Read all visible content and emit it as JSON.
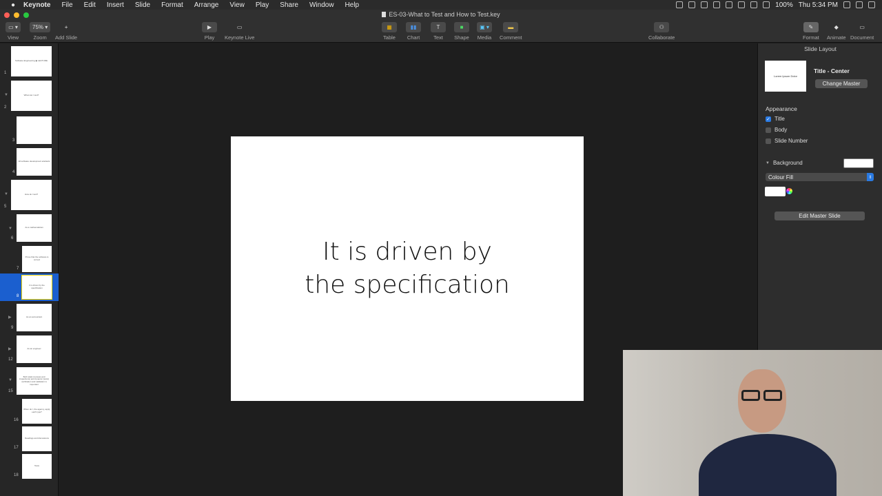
{
  "menubar": {
    "apple": "",
    "items": [
      "Keynote",
      "File",
      "Edit",
      "Insert",
      "Slide",
      "Format",
      "Arrange",
      "View",
      "Play",
      "Share",
      "Window",
      "Help"
    ],
    "battery": "100%",
    "clock": "Thu 5:34 PM"
  },
  "window": {
    "title": "ES-03-What to Test and How to Test.key"
  },
  "toolbar": {
    "view_label": "View",
    "zoom_value": "75%",
    "zoom_label": "Zoom",
    "add_slide_label": "Add Slide",
    "play_label": "Play",
    "keynote_live_label": "Keynote Live",
    "table_label": "Table",
    "chart_label": "Chart",
    "text_label": "Text",
    "shape_label": "Shape",
    "media_label": "Media",
    "comment_label": "Comment",
    "collaborate_label": "Collaborate",
    "format_label": "Format",
    "animate_label": "Animate",
    "document_label": "Document"
  },
  "navigator": {
    "slides": [
      {
        "num": "1",
        "text": "Software Engineering ◉ LECTURE"
      },
      {
        "num": "2",
        "text": "What can I test?"
      },
      {
        "num": "3",
        "text": ""
      },
      {
        "num": "4",
        "text": "All software development artefacts"
      },
      {
        "num": "5",
        "text": "How do I test?"
      },
      {
        "num": "6",
        "text": "As a mathematician"
      },
      {
        "num": "7",
        "text": "Prove that the software is correct"
      },
      {
        "num": "8",
        "text": "It is driven by the specification"
      },
      {
        "num": "9",
        "text": "As an accountant"
      },
      {
        "num": "12",
        "text": "As an engineer"
      },
      {
        "num": "15",
        "text": "Both static (reviews and inspections) and dynamic (tests) verification and validation is important"
      },
      {
        "num": "16",
        "text": "When do I, the agency, apply each type?"
      },
      {
        "num": "17",
        "text": "Readings and discussions"
      },
      {
        "num": "18",
        "text": "Tests"
      }
    ]
  },
  "slide": {
    "title": "It is driven by\nthe specification"
  },
  "inspector": {
    "header": "Slide Layout",
    "master_thumb_text": "Lorem Ipsum Dolor",
    "master_name": "Title - Center",
    "change_master": "Change Master",
    "appearance_label": "Appearance",
    "title_option": "Title",
    "body_option": "Body",
    "slide_number_option": "Slide Number",
    "background_label": "Background",
    "fill_type": "Colour Fill",
    "edit_master": "Edit Master Slide"
  },
  "colors": {
    "selection": "#1b5fcf",
    "accent": "#2a7ae2",
    "close": "#fe5f57",
    "minimize": "#febc2e",
    "zoom": "#28c840"
  }
}
